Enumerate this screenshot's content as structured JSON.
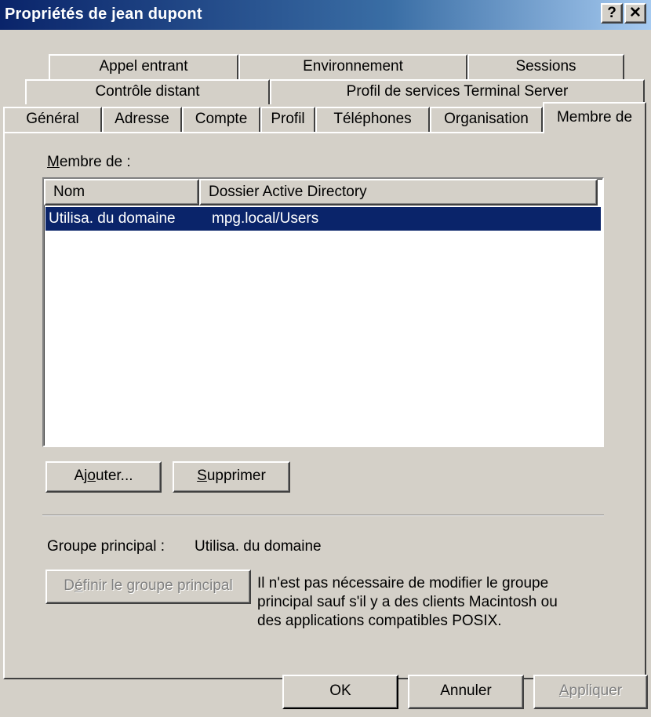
{
  "window": {
    "title": "Propriétés de jean dupont",
    "help_button": "?",
    "close_button": "✕"
  },
  "tabs": {
    "row1": [
      "Appel entrant",
      "Environnement",
      "Sessions"
    ],
    "row2": [
      "Contrôle distant",
      "Profil de services Terminal Server"
    ],
    "row3": [
      "Général",
      "Adresse",
      "Compte",
      "Profil",
      "Téléphones",
      "Organisation",
      "Membre de"
    ],
    "active": "Membre de"
  },
  "member_of": {
    "label_prefix": "M",
    "label_rest": "embre de :",
    "columns": [
      "Nom",
      "Dossier Active Directory"
    ],
    "rows": [
      {
        "name": "Utilisa. du domaine",
        "folder": "mpg.local/Users",
        "selected": true
      }
    ]
  },
  "buttons": {
    "add_pre": "Aj",
    "add_ul": "o",
    "add_post": "uter...",
    "remove_ul": "S",
    "remove_post": "upprimer",
    "set_primary_pre": "D",
    "set_primary_ul": "é",
    "set_primary_post": "finir le groupe principal",
    "ok": "OK",
    "cancel": "Annuler",
    "apply_ul": "A",
    "apply_post": "ppliquer"
  },
  "primary_group": {
    "label": "Groupe principal :",
    "value": "Utilisa. du domaine",
    "note_line1": "Il n'est pas nécessaire de modifier le groupe",
    "note_line2": "principal sauf s'il y a des clients Macintosh ou",
    "note_line3": "des applications compatibles POSIX."
  },
  "colors": {
    "selection": "#0a246a",
    "face": "#d4d0c8"
  }
}
